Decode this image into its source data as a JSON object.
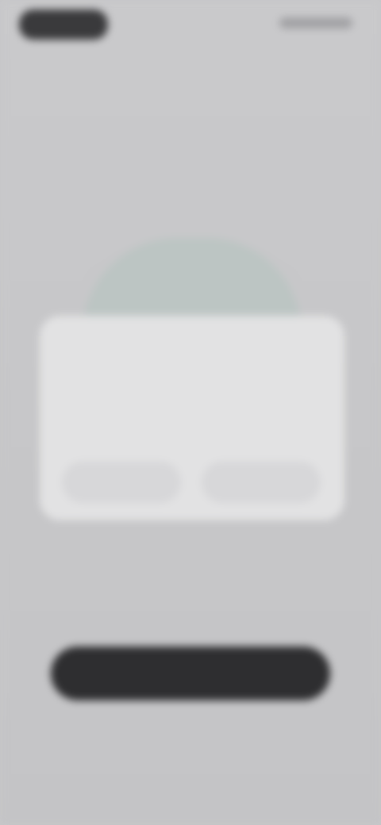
{
  "status_bar": {
    "left_pill": "",
    "right_icons": ""
  },
  "onboarding": {
    "title": "",
    "subtitle": ""
  },
  "permission_dialog": {
    "title": "",
    "message": "",
    "deny_label": "",
    "allow_label": ""
  },
  "actions": {
    "primary_label": "",
    "secondary_label": "",
    "footnote": ""
  },
  "colors": {
    "background": "#c7c7c9",
    "dialog": "#e2e2e3",
    "primary_button": "#2e2e30",
    "illustration": "#bcc5c3"
  }
}
